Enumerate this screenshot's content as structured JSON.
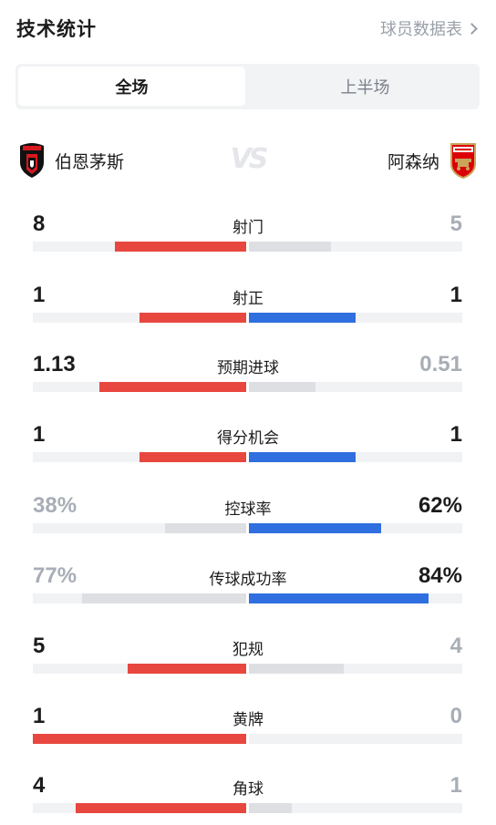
{
  "header": {
    "title": "技术统计",
    "player_link": "球员数据表"
  },
  "tabs": [
    {
      "label": "全场",
      "active": true
    },
    {
      "label": "上半场",
      "active": false
    }
  ],
  "teams": {
    "home": {
      "name": "伯恩茅斯",
      "crest_icon": "bournemouth-crest-icon"
    },
    "away": {
      "name": "阿森纳",
      "crest_icon": "arsenal-crest-icon"
    },
    "vs": "VS"
  },
  "colors": {
    "home": "#e8473f",
    "away": "#2f6fdf",
    "loser": "#dddfe3",
    "muted_text": "#a8adb6"
  },
  "stats": [
    {
      "label": "射门",
      "home": "8",
      "away": "5",
      "home_share": 0.615,
      "away_share": 0.385,
      "leader": "home"
    },
    {
      "label": "射正",
      "home": "1",
      "away": "1",
      "home_share": 0.5,
      "away_share": 0.5,
      "leader": "both"
    },
    {
      "label": "预期进球",
      "home": "1.13",
      "away": "0.51",
      "home_share": 0.69,
      "away_share": 0.31,
      "leader": "home"
    },
    {
      "label": "得分机会",
      "home": "1",
      "away": "1",
      "home_share": 0.5,
      "away_share": 0.5,
      "leader": "both"
    },
    {
      "label": "控球率",
      "home": "38%",
      "away": "62%",
      "home_share": 0.38,
      "away_share": 0.62,
      "leader": "away"
    },
    {
      "label": "传球成功率",
      "home": "77%",
      "away": "84%",
      "home_share": 0.77,
      "away_share": 0.84,
      "leader": "away"
    },
    {
      "label": "犯规",
      "home": "5",
      "away": "4",
      "home_share": 0.556,
      "away_share": 0.444,
      "leader": "home"
    },
    {
      "label": "黄牌",
      "home": "1",
      "away": "0",
      "home_share": 1.0,
      "away_share": 0.0,
      "leader": "home"
    },
    {
      "label": "角球",
      "home": "4",
      "away": "1",
      "home_share": 0.8,
      "away_share": 0.2,
      "leader": "home"
    }
  ]
}
